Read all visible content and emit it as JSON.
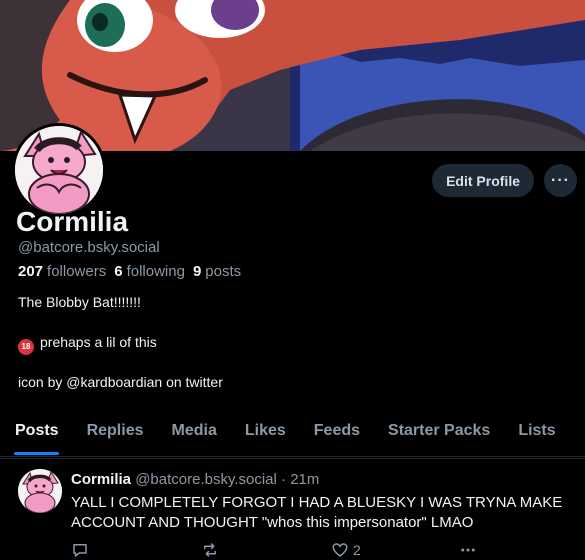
{
  "profile": {
    "display_name": "Cormilia",
    "handle": "@batcore.bsky.social",
    "stats": {
      "followers_count": "207",
      "followers_label": "followers",
      "following_count": "6",
      "following_label": "following",
      "posts_count": "9",
      "posts_label": "posts"
    },
    "bio": {
      "line1": "The Blobby Bat!!!!!!!",
      "line2_badge": "18",
      "line2": "prehaps a lil of this",
      "line3": "icon by @kardboardian on twitter"
    }
  },
  "actions": {
    "edit_profile_label": "Edit Profile",
    "more_label": "···"
  },
  "tabs": [
    {
      "label": "Posts"
    },
    {
      "label": "Replies"
    },
    {
      "label": "Media"
    },
    {
      "label": "Likes"
    },
    {
      "label": "Feeds"
    },
    {
      "label": "Starter Packs"
    },
    {
      "label": "Lists"
    }
  ],
  "active_tab": "Posts",
  "post": {
    "author_name": "Cormilia",
    "author_handle": "@batcore.bsky.social",
    "separator": "·",
    "time": "21m",
    "text": "YALL I COMPLETELY FORGOT I HAD A BLUESKY I WAS TRYNA MAKE ACCOUNT AND THOUGHT \"whos this impersonator\" LMAO",
    "like_count": "2",
    "icons": [
      "reply-icon",
      "repost-icon",
      "like-icon",
      "more-icon"
    ]
  },
  "colors": {
    "background": "#000000",
    "muted_text": "#8b98a5",
    "accent": "#1083fe",
    "button_bg": "#1e2936",
    "adult_badge": "#e0323c"
  }
}
